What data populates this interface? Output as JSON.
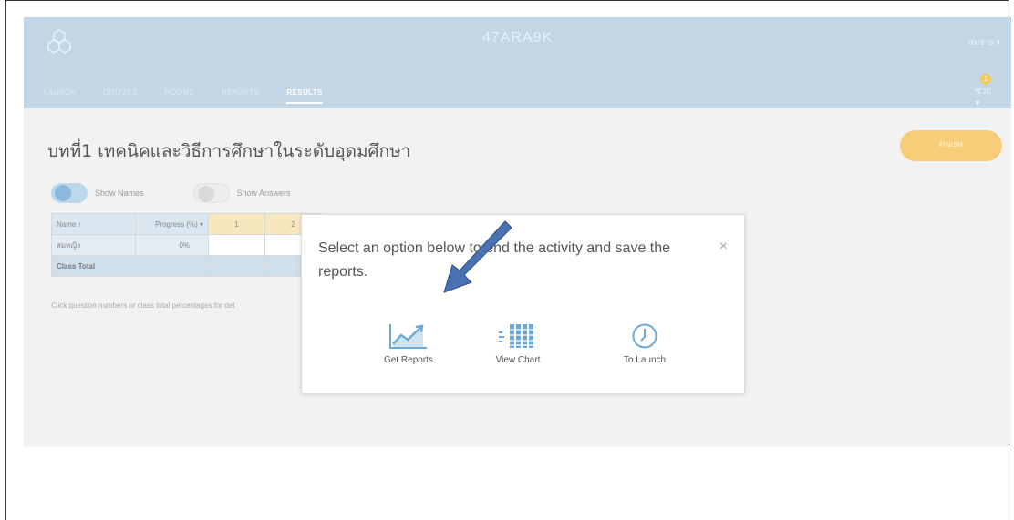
{
  "header": {
    "room_code": "47ARA9K",
    "user_menu": "สมชาย ▾",
    "notifications": {
      "count": "1",
      "label": "ช่วย ▾"
    }
  },
  "tabs": [
    {
      "label": "LAUNCH",
      "active": false
    },
    {
      "label": "QUIZZES",
      "active": false
    },
    {
      "label": "ROOMS",
      "active": false
    },
    {
      "label": "REPORTS",
      "active": false
    },
    {
      "label": "RESULTS",
      "active": true
    }
  ],
  "quiz": {
    "title": "บทที่1 เทคนิคและวิธีการศึกษาในระดับอุดมศึกษา",
    "finish_label": "FINISH"
  },
  "toggles": {
    "show_names": {
      "label": "Show Names",
      "on": true
    },
    "show_answers": {
      "label": "Show Answers",
      "on": false
    }
  },
  "table": {
    "headers": {
      "name": "Name ↑",
      "progress": "Progress (%) ▾",
      "questions": [
        "1",
        "2"
      ]
    },
    "rows": [
      {
        "name": "สมหญิง",
        "progress": "0%"
      }
    ],
    "total_label": "Class Total"
  },
  "hint": "Click question numbers or class total percentages for det",
  "modal": {
    "message": "Select an option below to end the activity and save the reports.",
    "close": "×",
    "options": [
      {
        "label": "Get Reports",
        "icon": "line-chart-icon"
      },
      {
        "label": "View Chart",
        "icon": "bar-chart-icon"
      },
      {
        "label": "To Launch",
        "icon": "clock-icon"
      }
    ]
  },
  "colors": {
    "header_bg": "#c3d6e6",
    "finish_bg": "#f7cd7a",
    "icon_blue": "#6aa9d8",
    "arrow": "#4a72b3"
  }
}
